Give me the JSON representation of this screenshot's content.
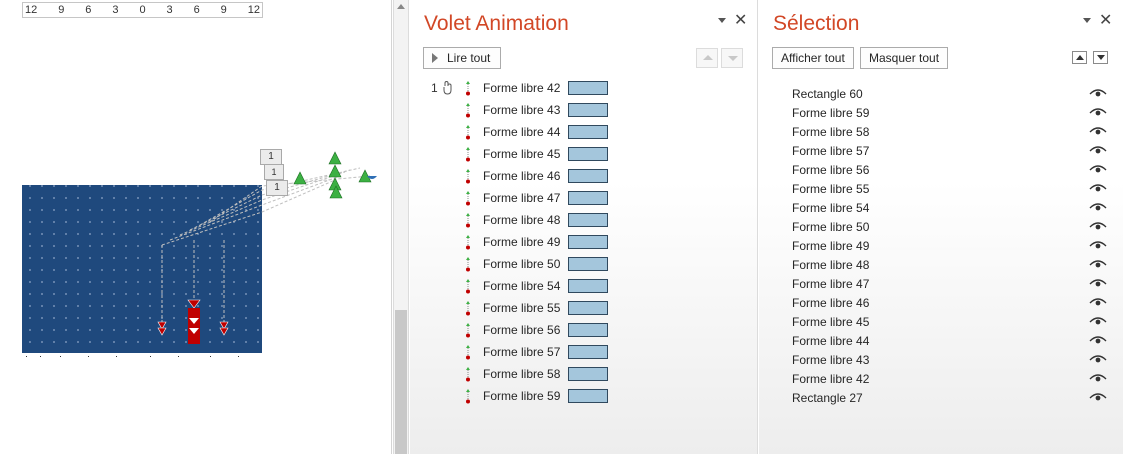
{
  "ruler": {
    "ticks": [
      "12",
      "9",
      "6",
      "3",
      "0",
      "3",
      "6",
      "9",
      "12"
    ]
  },
  "slide": {
    "background_color": "#1f497d",
    "sequence_tags": [
      "1",
      "1",
      "1"
    ],
    "motion_markers": 3
  },
  "animation_pane": {
    "title": "Volet Animation",
    "play_all_label": "Lire tout",
    "bar_color": "#a4c6dc",
    "items": [
      {
        "number": "1",
        "label": "Forme libre 42"
      },
      {
        "number": "",
        "label": "Forme libre 43"
      },
      {
        "number": "",
        "label": "Forme libre 44"
      },
      {
        "number": "",
        "label": "Forme libre 45"
      },
      {
        "number": "",
        "label": "Forme libre 46"
      },
      {
        "number": "",
        "label": "Forme libre 47"
      },
      {
        "number": "",
        "label": "Forme libre 48"
      },
      {
        "number": "",
        "label": "Forme libre 49"
      },
      {
        "number": "",
        "label": "Forme libre 50"
      },
      {
        "number": "",
        "label": "Forme libre 54"
      },
      {
        "number": "",
        "label": "Forme libre 55"
      },
      {
        "number": "",
        "label": "Forme libre 56"
      },
      {
        "number": "",
        "label": "Forme libre 57"
      },
      {
        "number": "",
        "label": "Forme libre 58"
      },
      {
        "number": "",
        "label": "Forme libre 59"
      }
    ]
  },
  "selection_pane": {
    "title": "Sélection",
    "show_all_label": "Afficher tout",
    "hide_all_label": "Masquer tout",
    "items": [
      "Rectangle 60",
      "Forme libre 59",
      "Forme libre 58",
      "Forme libre 57",
      "Forme libre 56",
      "Forme libre 55",
      "Forme libre 54",
      "Forme libre 50",
      "Forme libre 49",
      "Forme libre 48",
      "Forme libre 47",
      "Forme libre 46",
      "Forme libre 45",
      "Forme libre 44",
      "Forme libre 43",
      "Forme libre 42",
      "Rectangle 27"
    ]
  },
  "colors": {
    "accent": "#d24726",
    "effect_green": "#3cb043",
    "effect_red": "#c00000"
  }
}
